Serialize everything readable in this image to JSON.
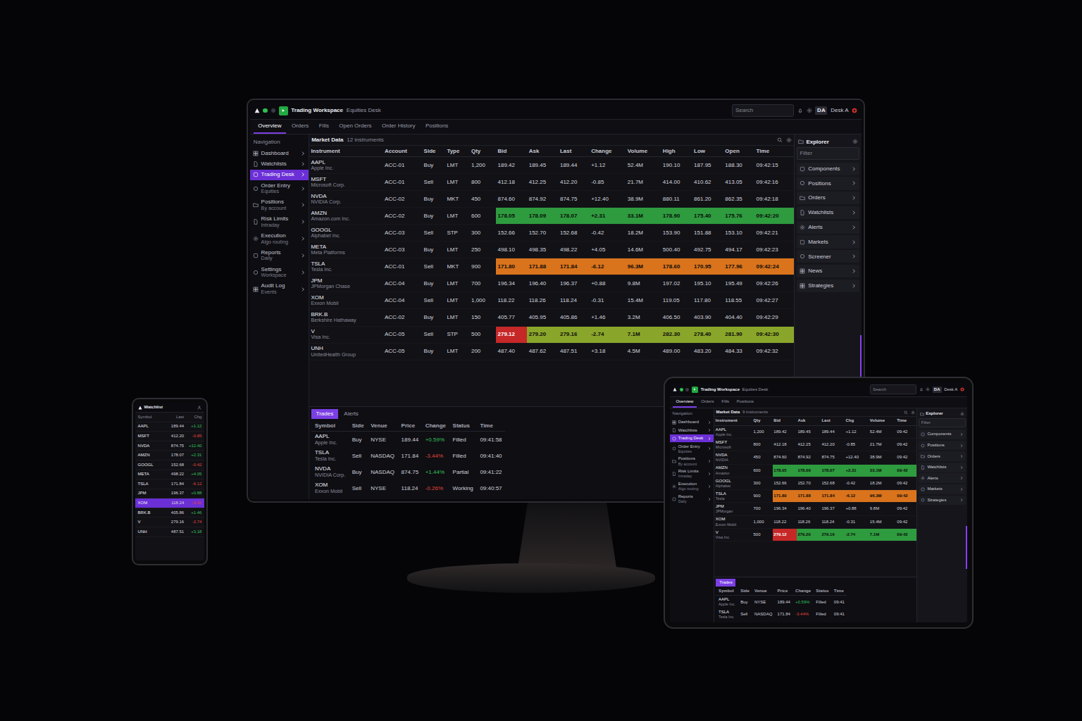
{
  "monitor": {
    "app_title": "Trading Workspace",
    "workspace": "Equities Desk",
    "search": {
      "placeholder": "Search"
    },
    "account": {
      "initials": "DA",
      "name": "Desk A"
    },
    "menu_tabs": [
      {
        "label": "Overview",
        "selected": true
      },
      {
        "label": "Orders",
        "selected": false
      },
      {
        "label": "Fills",
        "selected": false
      },
      {
        "label": "Open Orders",
        "selected": false
      },
      {
        "label": "Order History",
        "selected": false
      },
      {
        "label": "Positions",
        "selected": false
      }
    ],
    "sidebar": {
      "title": "Navigation",
      "items": [
        {
          "label": "Dashboard",
          "sub": "",
          "selected": false
        },
        {
          "label": "Watchlists",
          "sub": "",
          "selected": false
        },
        {
          "label": "Trading Desk",
          "sub": "",
          "selected": true
        },
        {
          "label": "Order Entry",
          "sub": "Equities",
          "selected": false
        },
        {
          "label": "Positions",
          "sub": "By account",
          "selected": false
        },
        {
          "label": "Risk Limits",
          "sub": "Intraday",
          "selected": false
        },
        {
          "label": "Execution",
          "sub": "Algo routing",
          "selected": false
        },
        {
          "label": "Reports",
          "sub": "Daily",
          "selected": false
        },
        {
          "label": "Settings",
          "sub": "Workspace",
          "selected": false
        },
        {
          "label": "Audit Log",
          "sub": "Events",
          "selected": false
        }
      ]
    },
    "table": {
      "title": "Market Data",
      "subtitle": "12 instruments",
      "columns": [
        {
          "label": "Instrument",
          "kind": "text"
        },
        {
          "label": "Account",
          "kind": "text"
        },
        {
          "label": "Side",
          "kind": "text"
        },
        {
          "label": "Type",
          "kind": "text"
        },
        {
          "label": "Qty",
          "kind": "text"
        },
        {
          "label": "Bid",
          "kind": "number"
        },
        {
          "label": "Ask",
          "kind": "number"
        },
        {
          "label": "Last",
          "kind": "number"
        },
        {
          "label": "Change",
          "kind": "number"
        },
        {
          "label": "Volume",
          "kind": "number"
        },
        {
          "label": "High",
          "kind": "number"
        },
        {
          "label": "Low",
          "kind": "number"
        },
        {
          "label": "Open",
          "kind": "number"
        },
        {
          "label": "Time",
          "kind": "number"
        }
      ],
      "rows": [
        {
          "name": "AAPL",
          "desc": "Apple Inc.",
          "cells": [
            "ACC-01",
            "Buy",
            "LMT",
            "1,200",
            "189.42",
            "189.45",
            "189.44",
            "+1.12",
            "52.4M",
            "190.10",
            "187.95",
            "188.30",
            "09:42:15"
          ]
        },
        {
          "name": "MSFT",
          "desc": "Microsoft Corp.",
          "cells": [
            "ACC-01",
            "Sell",
            "LMT",
            "800",
            "412.18",
            "412.25",
            "412.20",
            "-0.85",
            "21.7M",
            "414.00",
            "410.62",
            "413.05",
            "09:42:16"
          ]
        },
        {
          "name": "NVDA",
          "desc": "NVIDIA Corp.",
          "cells": [
            "ACC-02",
            "Buy",
            "MKT",
            "450",
            "874.60",
            "874.92",
            "874.75",
            "+12.40",
            "38.9M",
            "880.11",
            "861.20",
            "862.35",
            "09:42:18"
          ]
        },
        {
          "name": "AMZN",
          "desc": "Amazon.com Inc.",
          "cells": [
            "ACC-02",
            "Buy",
            "LMT",
            "600",
            "178.05",
            "178.09",
            "178.07",
            "+2.31",
            "33.1M",
            "178.90",
            "175.40",
            "175.76",
            "09:42:20"
          ],
          "color": "#2e9b3e"
        },
        {
          "name": "GOOGL",
          "desc": "Alphabet Inc.",
          "cells": [
            "ACC-03",
            "Sell",
            "STP",
            "300",
            "152.66",
            "152.70",
            "152.68",
            "-0.42",
            "18.2M",
            "153.90",
            "151.88",
            "153.10",
            "09:42:21"
          ]
        },
        {
          "name": "META",
          "desc": "Meta Platforms",
          "cells": [
            "ACC-03",
            "Buy",
            "LMT",
            "250",
            "498.10",
            "498.35",
            "498.22",
            "+4.05",
            "14.6M",
            "500.40",
            "492.75",
            "494.17",
            "09:42:23"
          ]
        },
        {
          "name": "TSLA",
          "desc": "Tesla Inc.",
          "cells": [
            "ACC-01",
            "Sell",
            "MKT",
            "900",
            "171.80",
            "171.88",
            "171.84",
            "-6.12",
            "96.3M",
            "178.60",
            "170.95",
            "177.96",
            "09:42:24"
          ],
          "color": "#d9731c"
        },
        {
          "name": "JPM",
          "desc": "JPMorgan Chase",
          "cells": [
            "ACC-04",
            "Buy",
            "LMT",
            "700",
            "196.34",
            "196.40",
            "196.37",
            "+0.88",
            "9.8M",
            "197.02",
            "195.10",
            "195.49",
            "09:42:26"
          ]
        },
        {
          "name": "XOM",
          "desc": "Exxon Mobil",
          "cells": [
            "ACC-04",
            "Sell",
            "LMT",
            "1,000",
            "118.22",
            "118.26",
            "118.24",
            "-0.31",
            "15.4M",
            "119.05",
            "117.80",
            "118.55",
            "09:42:27"
          ]
        },
        {
          "name": "BRK.B",
          "desc": "Berkshire Hathaway",
          "cells": [
            "ACC-02",
            "Buy",
            "LMT",
            "150",
            "405.77",
            "405.95",
            "405.86",
            "+1.46",
            "3.2M",
            "406.50",
            "403.90",
            "404.40",
            "09:42:29"
          ]
        },
        {
          "name": "V",
          "desc": "Visa Inc.",
          "cells": [
            "ACC-05",
            "Sell",
            "STP",
            "500",
            "279.12",
            "279.20",
            "279.16",
            "-2.74",
            "7.1M",
            "282.30",
            "278.40",
            "281.90",
            "09:42:30"
          ],
          "color": "#8aa62a",
          "flag_color": "#c62828"
        },
        {
          "name": "UNH",
          "desc": "UnitedHealth Group",
          "cells": [
            "ACC-05",
            "Buy",
            "LMT",
            "200",
            "487.40",
            "487.62",
            "487.51",
            "+3.18",
            "4.5M",
            "489.00",
            "483.20",
            "484.33",
            "09:42:32"
          ]
        }
      ]
    },
    "bottom": {
      "tabs": [
        {
          "label": "Trades",
          "selected": true
        },
        {
          "label": "Alerts",
          "selected": false
        }
      ],
      "columns": [
        "Symbol",
        "Side",
        "Venue",
        "Price",
        "Change",
        "Status",
        "Time"
      ],
      "rows": [
        {
          "symbol": "AAPL",
          "desc": "Apple Inc.",
          "side": "Buy",
          "venue": "NYSE",
          "price": "189.44",
          "change": "+0.59%",
          "direction": "up",
          "status": "Filled",
          "time": "09:41:58"
        },
        {
          "symbol": "TSLA",
          "desc": "Tesla Inc.",
          "side": "Sell",
          "venue": "NASDAQ",
          "price": "171.84",
          "change": "-3.44%",
          "direction": "down",
          "status": "Filled",
          "time": "09:41:40"
        },
        {
          "symbol": "NVDA",
          "desc": "NVIDIA Corp.",
          "side": "Buy",
          "venue": "NASDAQ",
          "price": "874.75",
          "change": "+1.44%",
          "direction": "up",
          "status": "Partial",
          "time": "09:41:22"
        },
        {
          "symbol": "XOM",
          "desc": "Exxon Mobil",
          "side": "Sell",
          "venue": "NYSE",
          "price": "118.24",
          "change": "-0.26%",
          "direction": "down",
          "status": "Working",
          "time": "09:40:57"
        }
      ]
    },
    "panel": {
      "title": "Explorer",
      "filter_placeholder": "Filter",
      "items": [
        {
          "label": "Components"
        },
        {
          "label": "Positions"
        },
        {
          "label": "Orders"
        },
        {
          "label": "Watchlists"
        },
        {
          "label": "Alerts"
        },
        {
          "label": "Markets"
        },
        {
          "label": "Screener"
        },
        {
          "label": "News"
        },
        {
          "label": "Strategies"
        }
      ]
    }
  },
  "tablet": {
    "app_title": "Trading Workspace",
    "workspace": "Equities Desk",
    "search": {
      "placeholder": "Search"
    },
    "account": {
      "initials": "DA",
      "name": "Desk A"
    },
    "menu_tabs": [
      {
        "label": "Overview",
        "selected": true
      },
      {
        "label": "Orders",
        "selected": false
      },
      {
        "label": "Fills",
        "selected": false
      },
      {
        "label": "Positions",
        "selected": false
      }
    ],
    "sidebar": {
      "title": "Navigation",
      "items": [
        {
          "label": "Dashboard",
          "sub": "",
          "selected": false
        },
        {
          "label": "Watchlists",
          "sub": "",
          "selected": false
        },
        {
          "label": "Trading Desk",
          "sub": "",
          "selected": true
        },
        {
          "label": "Order Entry",
          "sub": "Equities",
          "selected": false
        },
        {
          "label": "Positions",
          "sub": "By account",
          "selected": false
        },
        {
          "label": "Risk Limits",
          "sub": "Intraday",
          "selected": false
        },
        {
          "label": "Execution",
          "sub": "Algo routing",
          "selected": false
        },
        {
          "label": "Reports",
          "sub": "Daily",
          "selected": false
        }
      ]
    },
    "table": {
      "title": "Market Data",
      "subtitle": "9 instruments",
      "columns": [
        {
          "label": "Instrument",
          "kind": "text"
        },
        {
          "label": "Qty",
          "kind": "text"
        },
        {
          "label": "Bid",
          "kind": "number"
        },
        {
          "label": "Ask",
          "kind": "number"
        },
        {
          "label": "Last",
          "kind": "number"
        },
        {
          "label": "Chg",
          "kind": "number"
        },
        {
          "label": "Volume",
          "kind": "number"
        },
        {
          "label": "Time",
          "kind": "number"
        }
      ],
      "rows": [
        {
          "name": "AAPL",
          "desc": "Apple Inc.",
          "cells": [
            "1,200",
            "189.42",
            "189.45",
            "189.44",
            "+1.12",
            "52.4M",
            "09:42"
          ]
        },
        {
          "name": "MSFT",
          "desc": "Microsoft",
          "cells": [
            "800",
            "412.18",
            "412.25",
            "412.20",
            "-0.85",
            "21.7M",
            "09:42"
          ]
        },
        {
          "name": "NVDA",
          "desc": "NVIDIA",
          "cells": [
            "450",
            "874.60",
            "874.92",
            "874.75",
            "+12.40",
            "38.9M",
            "09:42"
          ]
        },
        {
          "name": "AMZN",
          "desc": "Amazon",
          "cells": [
            "600",
            "178.05",
            "178.09",
            "178.07",
            "+2.31",
            "33.1M",
            "09:42"
          ],
          "color": "#2e9b3e"
        },
        {
          "name": "GOOGL",
          "desc": "Alphabet",
          "cells": [
            "300",
            "152.66",
            "152.70",
            "152.68",
            "-0.42",
            "18.2M",
            "09:42"
          ]
        },
        {
          "name": "TSLA",
          "desc": "Tesla",
          "cells": [
            "900",
            "171.80",
            "171.88",
            "171.84",
            "-6.12",
            "96.3M",
            "09:42"
          ],
          "color": "#d9731c"
        },
        {
          "name": "JPM",
          "desc": "JPMorgan",
          "cells": [
            "700",
            "196.34",
            "196.40",
            "196.37",
            "+0.88",
            "9.8M",
            "09:42"
          ]
        },
        {
          "name": "XOM",
          "desc": "Exxon Mobil",
          "cells": [
            "1,000",
            "118.22",
            "118.26",
            "118.24",
            "-0.31",
            "15.4M",
            "09:42"
          ]
        },
        {
          "name": "V",
          "desc": "Visa Inc.",
          "cells": [
            "500",
            "279.12",
            "279.20",
            "279.16",
            "-2.74",
            "7.1M",
            "09:42"
          ],
          "color": "#2e9b3e",
          "flag_color": "#c62828"
        }
      ]
    },
    "bottom": {
      "tabs": [
        {
          "label": "Trades",
          "selected": true
        }
      ],
      "columns": [
        "Symbol",
        "Side",
        "Venue",
        "Price",
        "Change",
        "Status",
        "Time"
      ],
      "rows": [
        {
          "symbol": "AAPL",
          "desc": "Apple Inc.",
          "side": "Buy",
          "venue": "NYSE",
          "price": "189.44",
          "change": "+0.59%",
          "direction": "up",
          "status": "Filled",
          "time": "09:41"
        },
        {
          "symbol": "TSLA",
          "desc": "Tesla Inc.",
          "side": "Sell",
          "venue": "NASDAQ",
          "price": "171.84",
          "change": "-3.44%",
          "direction": "down",
          "status": "Filled",
          "time": "09:41"
        }
      ]
    },
    "panel": {
      "title": "Explorer",
      "filter_placeholder": "Filter",
      "items": [
        {
          "label": "Components"
        },
        {
          "label": "Positions"
        },
        {
          "label": "Orders"
        },
        {
          "label": "Watchlists"
        },
        {
          "label": "Alerts"
        },
        {
          "label": "Markets"
        },
        {
          "label": "Strategies"
        }
      ]
    }
  },
  "phone": {
    "title": "Watchlist",
    "columns": [
      "Symbol",
      "Last",
      "Chg"
    ],
    "rows": [
      {
        "symbol": "AAPL",
        "price": "189.44",
        "change": "+1.12",
        "direction": "up",
        "selected": false
      },
      {
        "symbol": "MSFT",
        "price": "412.20",
        "change": "-0.85",
        "direction": "down",
        "selected": false
      },
      {
        "symbol": "NVDA",
        "price": "874.75",
        "change": "+12.40",
        "direction": "up",
        "selected": false
      },
      {
        "symbol": "AMZN",
        "price": "178.07",
        "change": "+2.31",
        "direction": "up",
        "selected": false
      },
      {
        "symbol": "GOOGL",
        "price": "152.68",
        "change": "-0.42",
        "direction": "down",
        "selected": false
      },
      {
        "symbol": "META",
        "price": "498.22",
        "change": "+4.05",
        "direction": "up",
        "selected": false
      },
      {
        "symbol": "TSLA",
        "price": "171.84",
        "change": "-6.12",
        "direction": "down",
        "selected": false
      },
      {
        "symbol": "JPM",
        "price": "196.37",
        "change": "+0.88",
        "direction": "up",
        "selected": false
      },
      {
        "symbol": "XOM",
        "price": "118.24",
        "change": "-0.31",
        "direction": "down",
        "selected": true
      },
      {
        "symbol": "BRK.B",
        "price": "405.86",
        "change": "+1.46",
        "direction": "up",
        "selected": false
      },
      {
        "symbol": "V",
        "price": "279.16",
        "change": "-2.74",
        "direction": "down",
        "selected": false
      },
      {
        "symbol": "UNH",
        "price": "487.51",
        "change": "+3.18",
        "direction": "up",
        "selected": false
      }
    ]
  }
}
